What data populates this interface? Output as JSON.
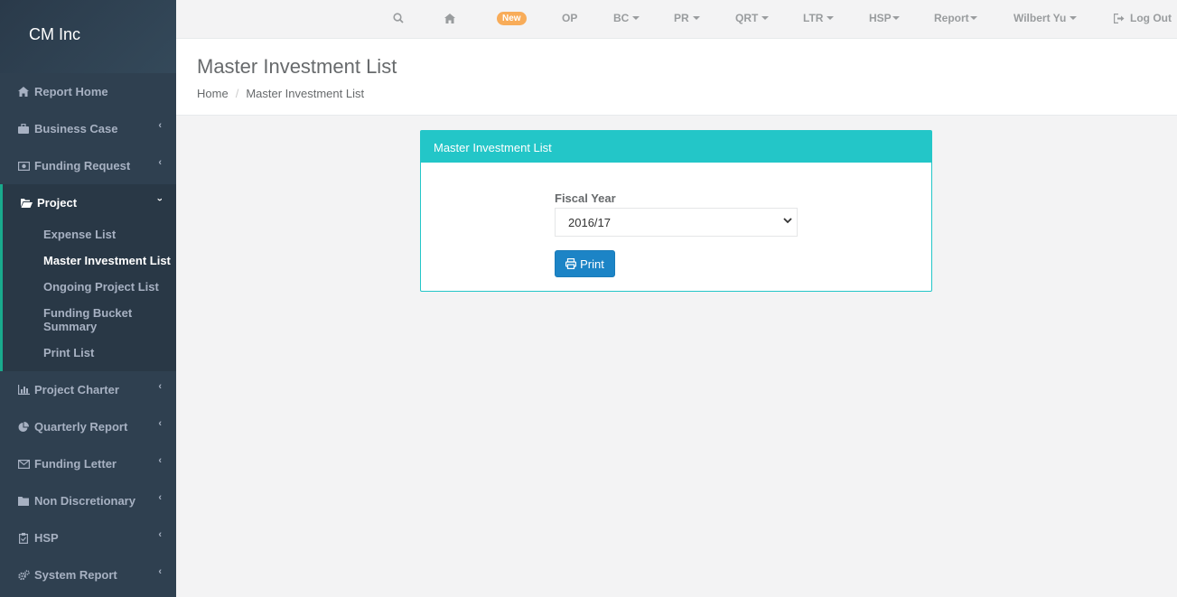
{
  "brand": "CM Inc",
  "sidebar": {
    "items": [
      {
        "label": "Report Home",
        "icon": "home-icon"
      },
      {
        "label": "Business Case",
        "icon": "briefcase-icon"
      },
      {
        "label": "Funding Request",
        "icon": "money-icon"
      },
      {
        "label": "Project",
        "icon": "folder-open-icon"
      },
      {
        "label": "Project Charter",
        "icon": "bar-chart-icon"
      },
      {
        "label": "Quarterly Report",
        "icon": "pie-chart-icon"
      },
      {
        "label": "Funding Letter",
        "icon": "envelope-icon"
      },
      {
        "label": "Non Discretionary",
        "icon": "folder-icon"
      },
      {
        "label": "HSP",
        "icon": "clipboard-icon"
      },
      {
        "label": "System Report",
        "icon": "cogs-icon"
      }
    ],
    "project_sub": [
      "Expense List",
      "Master Investment List",
      "Ongoing Project List",
      "Funding Bucket Summary",
      "Print List"
    ]
  },
  "topnav": {
    "new_badge": "New",
    "op": "OP",
    "bc": "BC",
    "pr": "PR",
    "qrt": "QRT",
    "ltr": "LTR",
    "hsp": "HSP",
    "report": "Report",
    "user": "Wilbert Yu",
    "logout": "Log Out"
  },
  "heading": {
    "title": "Master Investment List",
    "breadcrumb_home": "Home",
    "breadcrumb_current": "Master Investment List"
  },
  "panel": {
    "title": "Master Investment List",
    "fiscal_label": "Fiscal Year",
    "fiscal_value": "2016/17",
    "print_label": "Print"
  },
  "colors": {
    "sidebar_bg": "#2f4050",
    "accent_teal": "#23c6c8",
    "active_border": "#19aa8d",
    "button_blue": "#1c84c6",
    "badge_orange": "#f8ac59"
  }
}
